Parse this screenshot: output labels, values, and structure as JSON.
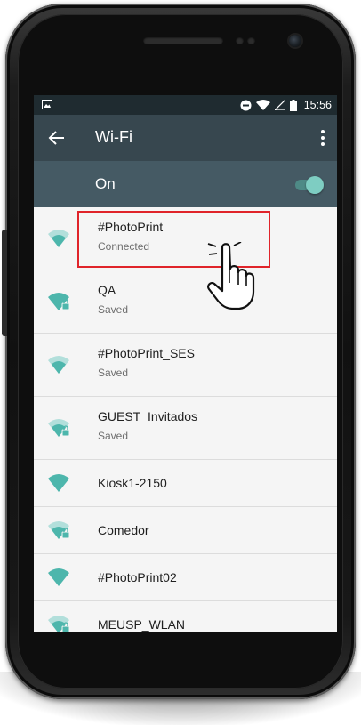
{
  "status_bar": {
    "time": "15:56",
    "icons": [
      "image-icon",
      "do-not-disturb-icon",
      "wifi-icon",
      "signal-icon",
      "battery-icon"
    ]
  },
  "app_bar": {
    "title": "Wi-Fi",
    "back_icon": "arrow-back-icon",
    "menu_icon": "more-vert-icon"
  },
  "wifi_toggle": {
    "label": "On",
    "enabled": true
  },
  "networks": [
    {
      "ssid": "#PhotoPrint",
      "status": "Connected",
      "secured": false,
      "signal": "medium"
    },
    {
      "ssid": "QA",
      "status": "Saved",
      "secured": true,
      "signal": "full"
    },
    {
      "ssid": "#PhotoPrint_SES",
      "status": "Saved",
      "secured": false,
      "signal": "medium"
    },
    {
      "ssid": "GUEST_Invitados",
      "status": "Saved",
      "secured": true,
      "signal": "medium"
    },
    {
      "ssid": "Kiosk1-2150",
      "status": "",
      "secured": false,
      "signal": "full"
    },
    {
      "ssid": "Comedor",
      "status": "",
      "secured": true,
      "signal": "medium"
    },
    {
      "ssid": "#PhotoPrint02",
      "status": "",
      "secured": false,
      "signal": "full"
    },
    {
      "ssid": "MEUSP_WLAN",
      "status": "",
      "secured": true,
      "signal": "medium"
    }
  ],
  "colors": {
    "status_bar": "#1f2b30",
    "app_bar": "#37474f",
    "switch_bar": "#455a64",
    "accent": "#4db6ac",
    "highlight": "#e0242a"
  }
}
